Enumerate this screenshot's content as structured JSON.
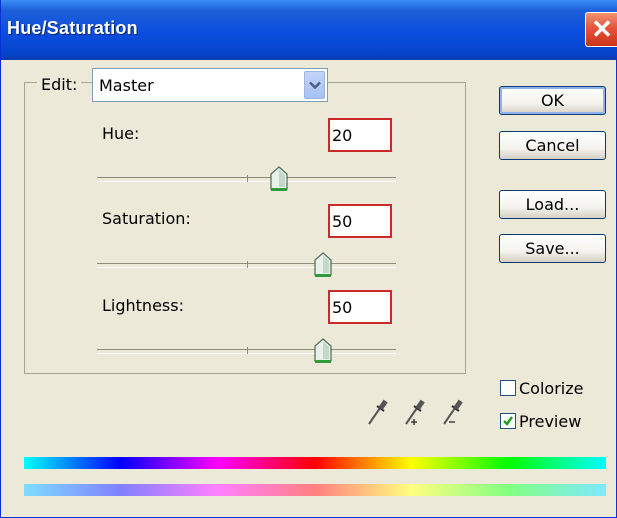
{
  "window": {
    "title": "Hue/Saturation",
    "close_symbol": "✕"
  },
  "edit": {
    "label": "Edit:",
    "value": "Master"
  },
  "adjustments": [
    {
      "label": "Hue:",
      "value": "20",
      "min": -180,
      "max": 180
    },
    {
      "label": "Saturation:",
      "value": "50",
      "min": -100,
      "max": 100
    },
    {
      "label": "Lightness:",
      "value": "50",
      "min": -100,
      "max": 100
    }
  ],
  "buttons": {
    "ok": "OK",
    "cancel": "Cancel",
    "load": "Load...",
    "save": "Save..."
  },
  "options": {
    "colorize": {
      "label": "Colorize",
      "checked": false
    },
    "preview": {
      "label": "Preview",
      "checked": true
    }
  },
  "eyedroppers": [
    "eyedropper-icon",
    "eyedropper-plus-icon",
    "eyedropper-minus-icon"
  ],
  "colors": {
    "highlight_border": "#cc2a2a",
    "titlebar": "#0a4ee0",
    "dialog_bg": "#ece9d8"
  }
}
